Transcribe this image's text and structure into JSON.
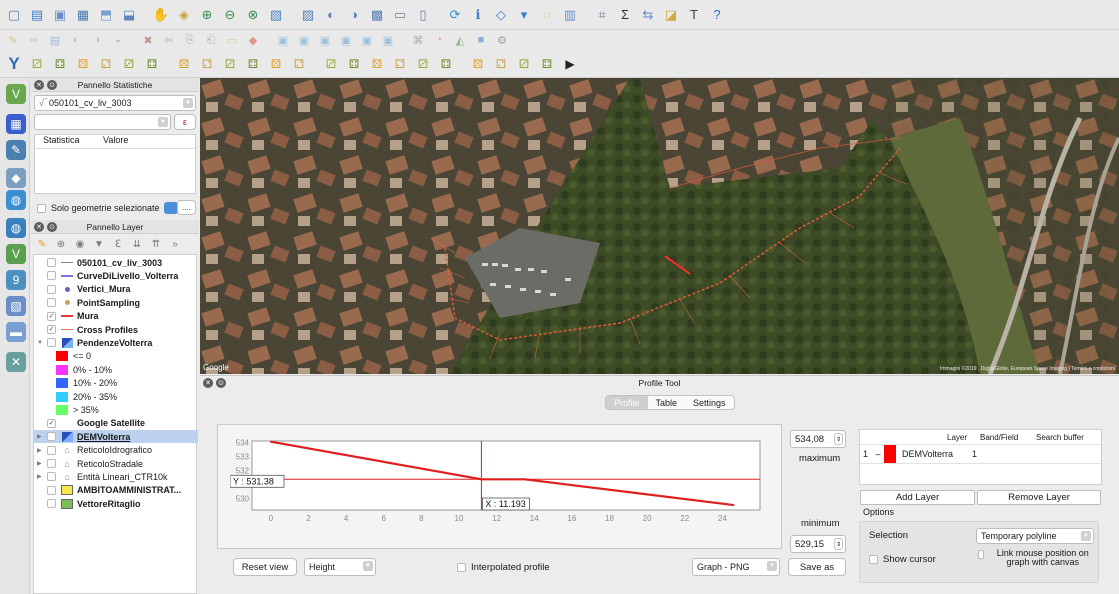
{
  "toolbar_row1": [
    "new-project",
    "open-project",
    "save-project",
    "save-as",
    "new-print-layout",
    "layout-manager",
    "pan-map",
    "pan-to-selection",
    "zoom-in",
    "zoom-out",
    "zoom-full",
    "zoom-to-selection",
    "zoom-to-layer",
    "zoom-last",
    "zoom-next",
    "new-map-view",
    "new-bookmark",
    "show-bookmarks",
    "refresh",
    "identify",
    "select-features",
    "select-dropdown",
    "deselect",
    "open-attribute-table",
    "field-calculator",
    "statistical-summary",
    "measure",
    "map-tips",
    "text-annotation",
    "help"
  ],
  "toolbar_row2": [
    "edits",
    "toggle-editing",
    "save-edits",
    "digitize-point",
    "vertex-tool",
    "move-feature",
    "node-tool",
    "delete-selected",
    "cut",
    "copy",
    "paste",
    "label",
    "style-manager",
    "pin-labels",
    "show-labels",
    "move-labels",
    "rotate-labels",
    "change-label",
    "csv",
    "processing",
    "python",
    "plugin-a",
    "plugin-b"
  ],
  "toolbar_row3_lead": "Y",
  "toolbar_row3": [
    "vector-tool-1",
    "vector-tool-2",
    "vector-tool-3",
    "vector-tool-4",
    "vector-tool-5",
    "vector-tool-6",
    "vector-tool-7",
    "vector-tool-8",
    "vector-tool-9",
    "vector-tool-10",
    "vector-tool-11",
    "vector-tool-12",
    "vector-tool-13",
    "vector-tool-14",
    "vector-tool-15",
    "vector-tool-16",
    "vector-tool-17",
    "vector-tool-18",
    "vector-tool-19",
    "vector-tool-20",
    "vector-tool-21",
    "vector-tool-22",
    "python-console"
  ],
  "stats_panel": {
    "title": "Pannello Statistiche",
    "layer_value": "050101_cv_liv_3003",
    "epsilon": "ε",
    "col_statistic": "Statistica",
    "col_value": "Valore",
    "only_selected": "Solo geometrie selezionate",
    "more": "...."
  },
  "layer_panel": {
    "title": "Pannello Layer",
    "layers": [
      {
        "name": "050101_cv_liv_3003",
        "bold": true,
        "checked": false,
        "symbol": "line",
        "color": "#7b8794",
        "expand": ""
      },
      {
        "name": "CurveDiLivello_Volterra",
        "bold": true,
        "checked": false,
        "symbol": "line",
        "color": "#8a6fd1",
        "expand": ""
      },
      {
        "name": "Vertici_Mura",
        "bold": true,
        "checked": false,
        "symbol": "dot",
        "color": "#6c5bbf",
        "expand": ""
      },
      {
        "name": "PointSampling",
        "bold": true,
        "checked": false,
        "symbol": "dot",
        "color": "#c9a15a",
        "expand": ""
      },
      {
        "name": "Mura",
        "bold": true,
        "checked": true,
        "symbol": "line",
        "color": "#e23b3b",
        "expand": ""
      },
      {
        "name": "Cross Profiles",
        "bold": true,
        "checked": true,
        "symbol": "line",
        "color": "#e8724a",
        "expand": ""
      },
      {
        "name": "PendenzeVolterra",
        "bold": true,
        "checked": false,
        "symbol": "raster",
        "color": "#3a5fcd",
        "expand": "▼"
      },
      {
        "name": "<= 0",
        "bold": false,
        "legend": true,
        "color": "#ff0000"
      },
      {
        "name": "0% - 10%",
        "bold": false,
        "legend": true,
        "color": "#ff33ff"
      },
      {
        "name": "10% - 20%",
        "bold": false,
        "legend": true,
        "color": "#3366ff"
      },
      {
        "name": "20% - 35%",
        "bold": false,
        "legend": true,
        "color": "#33ccff"
      },
      {
        "name": "> 35%",
        "bold": false,
        "legend": true,
        "color": "#66ff66"
      },
      {
        "name": "Google Satellite",
        "bold": true,
        "checked": true,
        "symbol": "none",
        "color": "#999999",
        "expand": ""
      },
      {
        "name": "DEMVolterra",
        "bold": true,
        "checked": false,
        "symbol": "raster",
        "color": "#3a5fcd",
        "expand": "▶",
        "selected": true,
        "underline": true
      },
      {
        "name": "ReticoloIdrografico",
        "bold": false,
        "checked": false,
        "symbol": "folder",
        "color": "#9a9a9a",
        "expand": "▶"
      },
      {
        "name": "ReticoloStradale",
        "bold": false,
        "checked": false,
        "symbol": "folder",
        "color": "#9a9a9a",
        "expand": "▶"
      },
      {
        "name": "Entità Lineari_CTR10k",
        "bold": false,
        "checked": false,
        "symbol": "folder",
        "color": "#9a9a9a",
        "expand": "▶"
      },
      {
        "name": "AMBITOAMMINISTRAT...",
        "bold": true,
        "checked": false,
        "symbol": "fill",
        "color": "#f4e84a",
        "expand": ""
      },
      {
        "name": "VettoreRitaglio",
        "bold": true,
        "checked": false,
        "symbol": "fill",
        "color": "#7cbf5a",
        "expand": ""
      }
    ]
  },
  "map": {
    "attribution_left": "Google",
    "attribution_right": "Immagini ©2019 , DigitalGlobe, European Space Imaging | Termini e condizioni"
  },
  "profile_tool": {
    "title": "Profile Tool",
    "tabs": [
      "Profile",
      "Table",
      "Settings"
    ],
    "active_tab": "Profile",
    "max_value": "534,08",
    "max_label": "maximum",
    "min_value": "529,15",
    "min_label": "minimum",
    "cursor_y_label": "Y : 531.38",
    "cursor_x_label": "X : 11.193",
    "reset_view": "Reset view",
    "mode": "Height",
    "interpolated": "Interpolated profile",
    "export_format": "Graph - PNG",
    "save_as": "Save as",
    "layer_table": {
      "headers": [
        "Layer",
        "Band/Field",
        "Search buffer"
      ],
      "rows": [
        {
          "index": "1",
          "dash": "–",
          "color": "#ff0000",
          "layer": "DEMVolterra",
          "band": "1",
          "buffer": ""
        }
      ]
    },
    "add_layer": "Add Layer",
    "remove_layer": "Remove Layer",
    "options_label": "Options",
    "selection_label": "Selection",
    "selection_value": "Temporary polyline",
    "show_cursor": "Show cursor",
    "link_mouse": "Link mouse position on graph with canvas"
  },
  "chart_data": {
    "type": "line",
    "title": "",
    "xlabel": "",
    "ylabel": "",
    "xlim": [
      -1,
      26
    ],
    "ylim": [
      529.2,
      534.1
    ],
    "xticks": [
      0,
      2,
      4,
      6,
      8,
      10,
      12,
      14,
      16,
      18,
      20,
      22,
      24
    ],
    "yticks": [
      530,
      531,
      532,
      533,
      534
    ],
    "series": [
      {
        "name": "",
        "color": "#e01e1e",
        "x": [
          0,
          11.2,
          13.5,
          24.6
        ],
        "y": [
          534.05,
          531.38,
          531.38,
          529.55
        ]
      }
    ],
    "cursor": {
      "x": 11.193,
      "y": 531.38
    }
  }
}
